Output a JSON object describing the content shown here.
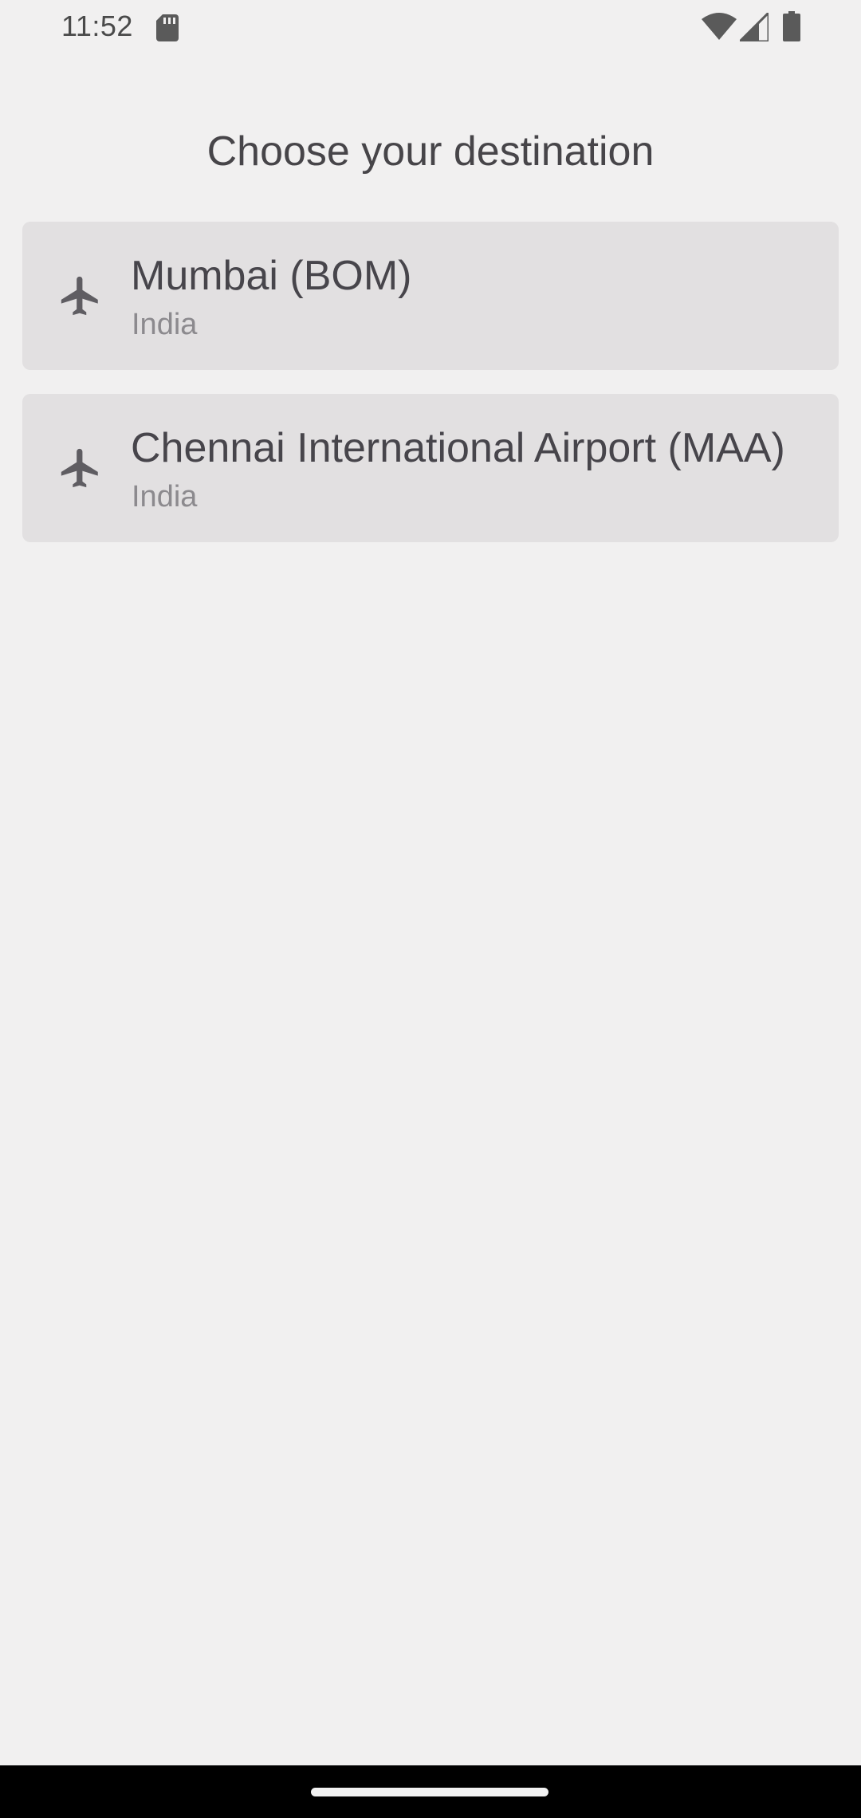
{
  "status_bar": {
    "time": "11:52",
    "icons": [
      "sd-card-icon",
      "wifi-icon",
      "signal-icon",
      "battery-icon"
    ]
  },
  "screen": {
    "title": "Choose your destination"
  },
  "destinations": [
    {
      "name": "Mumbai (BOM)",
      "country": "India",
      "icon": "airplane-icon"
    },
    {
      "name": "Chennai International Airport (MAA)",
      "country": "India",
      "icon": "airplane-icon"
    }
  ],
  "colors": {
    "background": "#f1f0f0",
    "card": "#e2e0e1",
    "primary_text": "#47454b",
    "secondary_text": "#8c8a8e",
    "icon": "#5f5d62",
    "nav_bar": "#000000"
  }
}
